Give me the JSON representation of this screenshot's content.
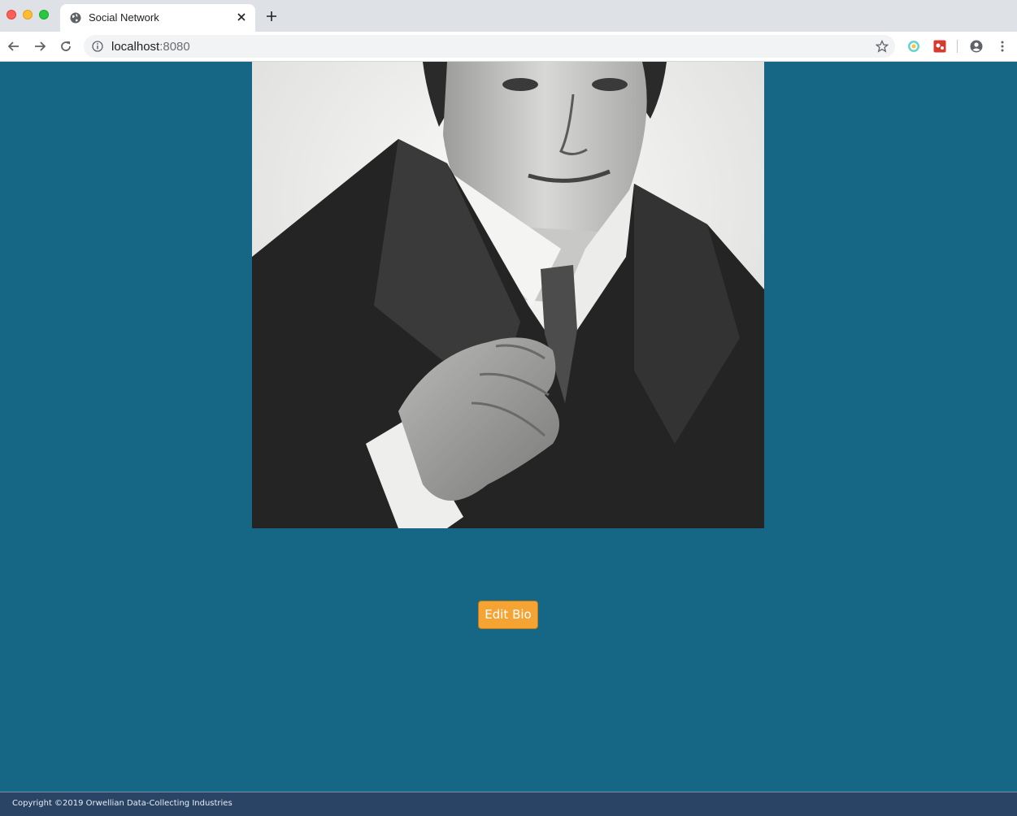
{
  "browser": {
    "tab_title": "Social Network",
    "url_host": "localhost",
    "url_port": ":8080"
  },
  "page": {
    "edit_bio_label": "Edit Bio",
    "footer_text": "Copyright ©2019 Orwellian Data-Collecting Industries"
  },
  "colors": {
    "page_background": "#166685",
    "button_accent": "#f5a332",
    "footer_background": "#2a4466"
  }
}
